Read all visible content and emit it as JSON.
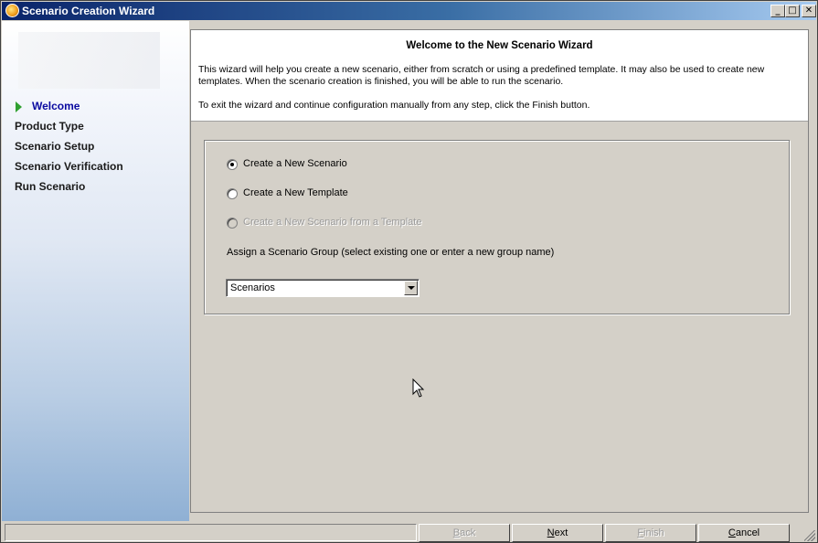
{
  "window": {
    "title": "Scenario Creation Wizard"
  },
  "sidebar": {
    "steps": [
      {
        "label": "Welcome",
        "active": true
      },
      {
        "label": "Product Type",
        "active": false
      },
      {
        "label": "Scenario Setup",
        "active": false
      },
      {
        "label": "Scenario Verification",
        "active": false
      },
      {
        "label": "Run Scenario",
        "active": false
      }
    ]
  },
  "header": {
    "title": "Welcome to the New Scenario Wizard",
    "description": "This wizard will help you create a new scenario, either from scratch or using a predefined template. It may also be used to create new templates. When the scenario creation is finished, you will be able to run the scenario.",
    "exit_note": "To exit the wizard and continue configuration manually from any step, click the Finish button."
  },
  "options": {
    "radios": [
      {
        "label": "Create a New Scenario",
        "checked": true,
        "enabled": true
      },
      {
        "label": "Create a New Template",
        "checked": false,
        "enabled": true
      },
      {
        "label": "Create a New Scenario from a Template",
        "checked": false,
        "enabled": false
      }
    ],
    "group_label": "Assign a Scenario Group (select existing one or enter a new group name)",
    "group_value": "Scenarios"
  },
  "buttons": {
    "back": {
      "pre": "",
      "ul": "B",
      "post": "ack",
      "enabled": false
    },
    "next": {
      "pre": "",
      "ul": "N",
      "post": "ext",
      "enabled": true
    },
    "finish": {
      "pre": "",
      "ul": "F",
      "post": "inish",
      "enabled": false
    },
    "cancel": {
      "pre": "",
      "ul": "C",
      "post": "ancel",
      "enabled": true
    }
  }
}
